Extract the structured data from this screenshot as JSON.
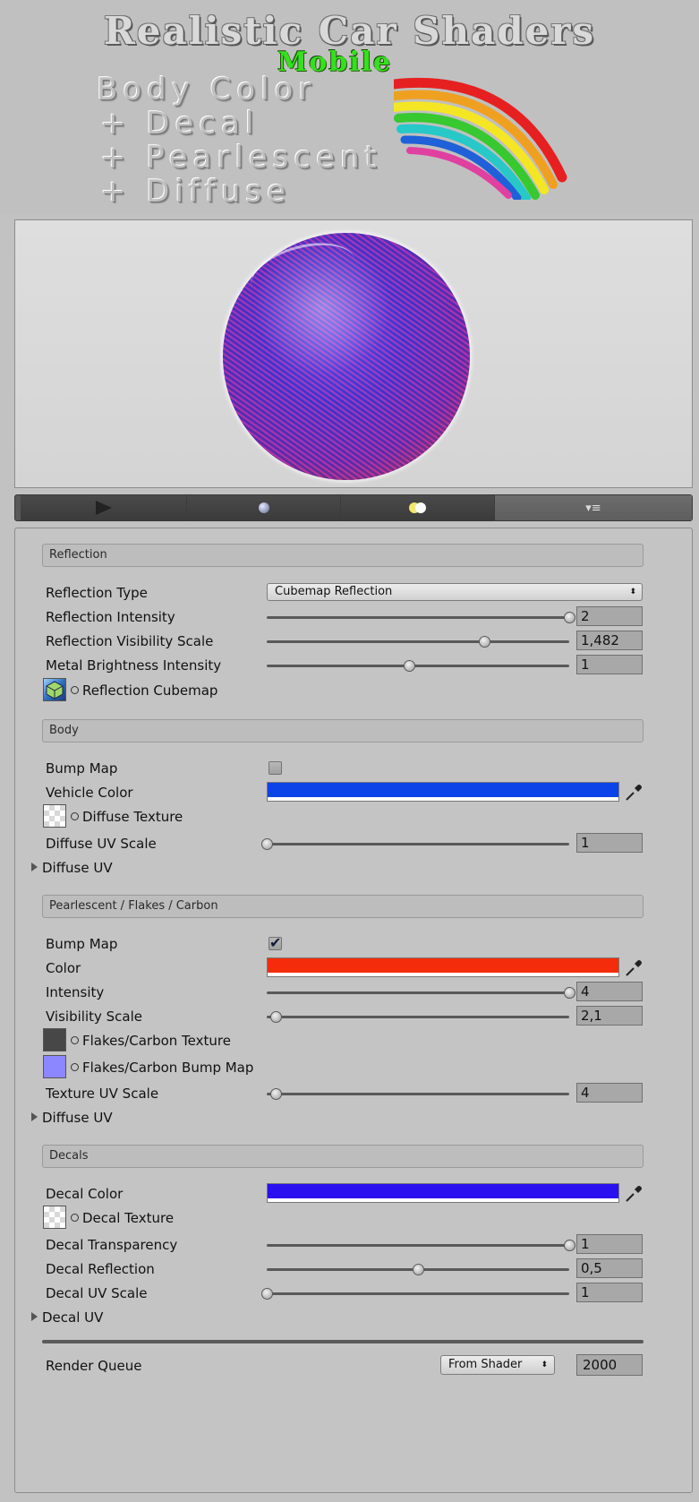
{
  "banner": {
    "title": "Realistic Car Shaders",
    "subtitle": "Mobile",
    "lines": [
      "Body Color",
      "+ Decal",
      "+ Pearlescent",
      "+ Diffuse"
    ]
  },
  "preview_toolbar": {
    "icons": [
      "play-icon",
      "sphere-icon",
      "light-icon",
      "menu-icon"
    ],
    "menu_glyph": "▾≡"
  },
  "sections": {
    "reflection": {
      "header": "Reflection",
      "type_label": "Reflection Type",
      "type_value": "Cubemap Reflection",
      "intensity_label": "Reflection Intensity",
      "intensity_value": "2",
      "intensity_fraction": 1.0,
      "visibility_label": "Reflection Visibility Scale",
      "visibility_value": "1,482",
      "visibility_fraction": 0.72,
      "metal_label": "Metal Brightness Intensity",
      "metal_value": "1",
      "metal_fraction": 0.47,
      "cubemap_label": "Reflection Cubemap"
    },
    "body": {
      "header": "Body",
      "bump_label": "Bump Map",
      "bump_checked": false,
      "vehicle_color_label": "Vehicle Color",
      "vehicle_color": "#0b43e9",
      "diffuse_texture_label": "Diffuse Texture",
      "uv_scale_label": "Diffuse UV Scale",
      "uv_scale_value": "1",
      "uv_scale_fraction": 0.0,
      "foldout_label": "Diffuse UV"
    },
    "pearlescent": {
      "header": "Pearlescent / Flakes / Carbon",
      "bump_label": "Bump Map",
      "bump_checked": true,
      "color_label": "Color",
      "color": "#f42c0c",
      "intensity_label": "Intensity",
      "intensity_value": "4",
      "intensity_fraction": 1.0,
      "visibility_label": "Visibility Scale",
      "visibility_value": "2,1",
      "visibility_fraction": 0.03,
      "flakes_texture_label": "Flakes/Carbon Texture",
      "flakes_texture_color": "#474747",
      "flakes_bump_label": "Flakes/Carbon Bump Map",
      "flakes_bump_color": "#8c86ff",
      "uv_scale_label": "Texture UV Scale",
      "uv_scale_value": "4",
      "uv_scale_fraction": 0.03,
      "foldout_label": "Diffuse UV"
    },
    "decals": {
      "header": "Decals",
      "color_label": "Decal Color",
      "color": "#2a10ee",
      "texture_label": "Decal Texture",
      "transparency_label": "Decal Transparency",
      "transparency_value": "1",
      "transparency_fraction": 1.0,
      "reflection_label": "Decal Reflection",
      "reflection_value": "0,5",
      "reflection_fraction": 0.5,
      "uv_scale_label": "Decal UV Scale",
      "uv_scale_value": "1",
      "uv_scale_fraction": 0.0,
      "foldout_label": "Decal UV"
    }
  },
  "render_queue": {
    "label": "Render Queue",
    "mode": "From Shader",
    "value": "2000"
  }
}
